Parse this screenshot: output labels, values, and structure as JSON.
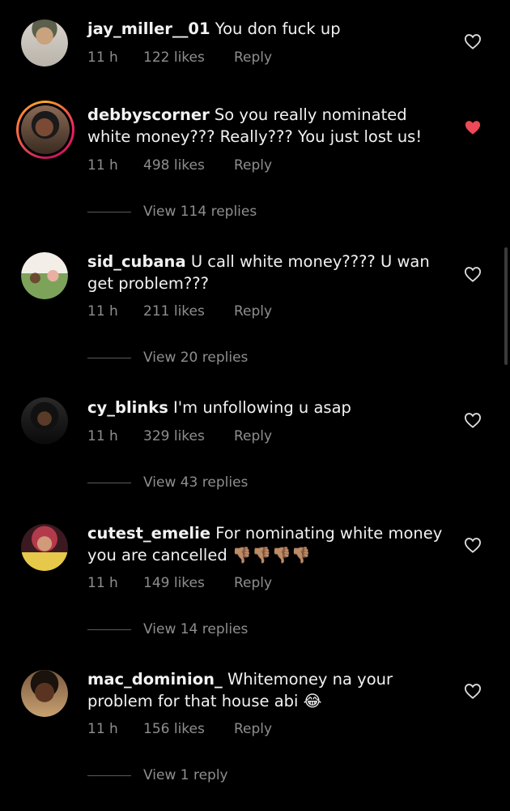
{
  "colors": {
    "background": "#000000",
    "text": "#f2f2f2",
    "meta": "#8e8e8e",
    "liked_heart": "#ed4956"
  },
  "comments": [
    {
      "username": "jay_miller__01",
      "text": "You don fuck up",
      "time": "11 h",
      "likes": "122 likes",
      "reply": "Reply",
      "liked": false,
      "view_replies": ""
    },
    {
      "username": "debbyscorner",
      "text": "So you really nominated white money??? Really??? You just lost us!",
      "time": "11 h",
      "likes": "498 likes",
      "reply": "Reply",
      "liked": true,
      "view_replies": "View 114 replies"
    },
    {
      "username": "sid_cubana",
      "text": "U call white money???? U wan get problem???",
      "time": "11 h",
      "likes": "211 likes",
      "reply": "Reply",
      "liked": false,
      "view_replies": "View 20 replies"
    },
    {
      "username": "cy_blinks",
      "text": "I'm unfollowing u asap",
      "time": "11 h",
      "likes": "329 likes",
      "reply": "Reply",
      "liked": false,
      "view_replies": "View 43 replies"
    },
    {
      "username": "cutest_emelie",
      "text": "For nominating white money you are cancelled 👎🏽👎🏽👎🏽👎🏽",
      "time": "11 h",
      "likes": "149 likes",
      "reply": "Reply",
      "liked": false,
      "view_replies": "View 14 replies"
    },
    {
      "username": "mac_dominion_",
      "text": "Whitemoney na your problem for that house abi 😂",
      "time": "11 h",
      "likes": "156 likes",
      "reply": "Reply",
      "liked": false,
      "view_replies": "View 1 reply"
    }
  ]
}
